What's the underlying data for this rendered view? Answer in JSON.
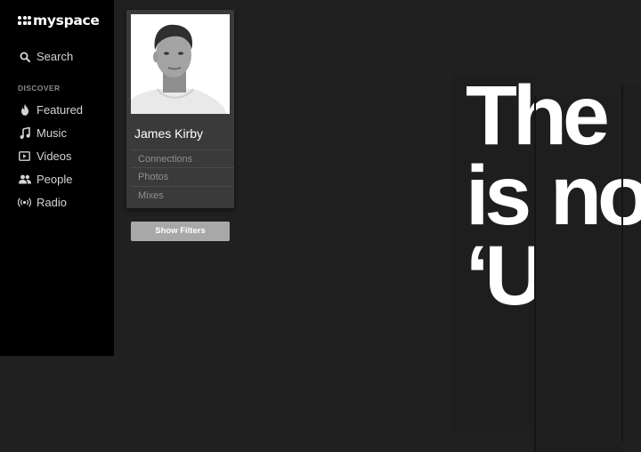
{
  "app": {
    "logo_text": "myspace"
  },
  "sidebar": {
    "search_label": "Search",
    "section_heading": "DISCOVER",
    "items": [
      {
        "label": "Featured",
        "icon": "flame-icon"
      },
      {
        "label": "Music",
        "icon": "music-note-icon"
      },
      {
        "label": "Videos",
        "icon": "video-icon"
      },
      {
        "label": "People",
        "icon": "people-icon"
      },
      {
        "label": "Radio",
        "icon": "radio-icon"
      }
    ]
  },
  "profile": {
    "name": "James Kirby",
    "links": [
      "Connections",
      "Photos",
      "Mixes"
    ],
    "show_filters_label": "Show Filters"
  },
  "poster": {
    "line1": "The",
    "line2a": "is",
    "line2b": "no",
    "line3": "‘U’"
  },
  "colors": {
    "background": "#202020",
    "sidebar": "#000000",
    "card": "#3a3a3a",
    "button": "#a8a8a8"
  }
}
